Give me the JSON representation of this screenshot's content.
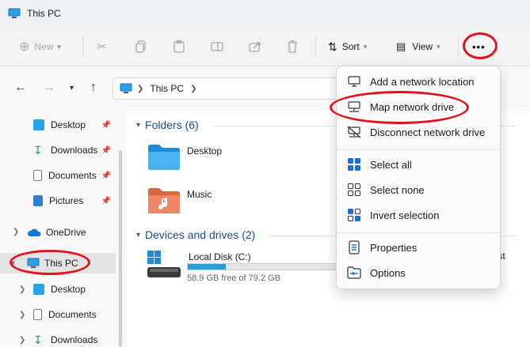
{
  "window": {
    "title": "This PC"
  },
  "toolbar": {
    "new_label": "New",
    "sort_label": "Sort",
    "view_label": "View",
    "more_label": "•••"
  },
  "address": {
    "path": [
      "This PC"
    ]
  },
  "sidebar": {
    "items": [
      {
        "label": "Desktop"
      },
      {
        "label": "Downloads"
      },
      {
        "label": "Documents"
      },
      {
        "label": "Pictures"
      },
      {
        "label": "OneDrive"
      },
      {
        "label": "This PC"
      },
      {
        "label": "Desktop"
      },
      {
        "label": "Documents"
      },
      {
        "label": "Downloads"
      }
    ]
  },
  "content": {
    "folders_header": "Folders (6)",
    "folders": [
      {
        "label": "Desktop"
      },
      {
        "label": "Music"
      }
    ],
    "drives_header": "Devices and drives (2)",
    "drive": {
      "label": "Local Disk (C:)",
      "free_text": "58.9 GB free of 79.2 GB",
      "used_fraction": 0.256
    },
    "partial_text": "uest"
  },
  "context_menu": {
    "items": [
      {
        "label": "Add a network location",
        "icon": "monitor-add-icon"
      },
      {
        "label": "Map network drive",
        "icon": "network-drive-icon"
      },
      {
        "label": "Disconnect network drive",
        "icon": "disconnect-drive-icon"
      },
      {
        "label": "Select all",
        "icon": "select-all-icon"
      },
      {
        "label": "Select none",
        "icon": "select-none-icon"
      },
      {
        "label": "Invert selection",
        "icon": "invert-selection-icon"
      },
      {
        "label": "Properties",
        "icon": "properties-icon"
      },
      {
        "label": "Options",
        "icon": "options-icon"
      }
    ]
  },
  "colors": {
    "annotation": "#e0141e",
    "accent": "#0067c0",
    "folder": "#1e8bd8"
  }
}
